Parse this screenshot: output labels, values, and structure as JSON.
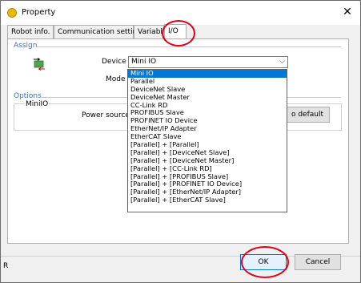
{
  "window": {
    "title": "Property",
    "close_glyph": "✕"
  },
  "tabs": [
    {
      "label": "Robot info.",
      "active": false
    },
    {
      "label": "Communication setting",
      "active": false
    },
    {
      "label": "Variable",
      "active": false
    },
    {
      "label": "I/O",
      "active": true
    }
  ],
  "assign": {
    "group_label": "Assign",
    "device_label": "Device",
    "device_value": "Mini IO",
    "mode_label": "Mode"
  },
  "options": {
    "group_label": "Options",
    "sub_label": "MiniIO",
    "power_source_label": "Power source:",
    "default_button_label": "o default"
  },
  "dropdown": {
    "items": [
      "Mini IO",
      "Parallel",
      "DeviceNet Slave",
      "DeviceNet Master",
      "CC-Link RD",
      "PROFIBUS Slave",
      "PROFINET IO Device",
      "EtherNet/IP Adapter",
      "EtherCAT Slave",
      "[Parallel] + [Parallel]",
      "[Parallel] + [DeviceNet Slave]",
      "[Parallel] + [DeviceNet Master]",
      "[Parallel] + [CC-Link RD]",
      "[Parallel] + [PROFIBUS Slave]",
      "[Parallel] + [PROFINET IO Device]",
      "[Parallel] + [EtherNet/IP Adapter]",
      "[Parallel] + [EtherCAT Slave]"
    ],
    "selected_index": 0
  },
  "footer": {
    "ok_label": "OK",
    "cancel_label": "Cancel",
    "left_stub": "R"
  },
  "colors": {
    "selection": "#0078d7",
    "annotation": "#e0001b",
    "group_label": "#3f72b6"
  }
}
